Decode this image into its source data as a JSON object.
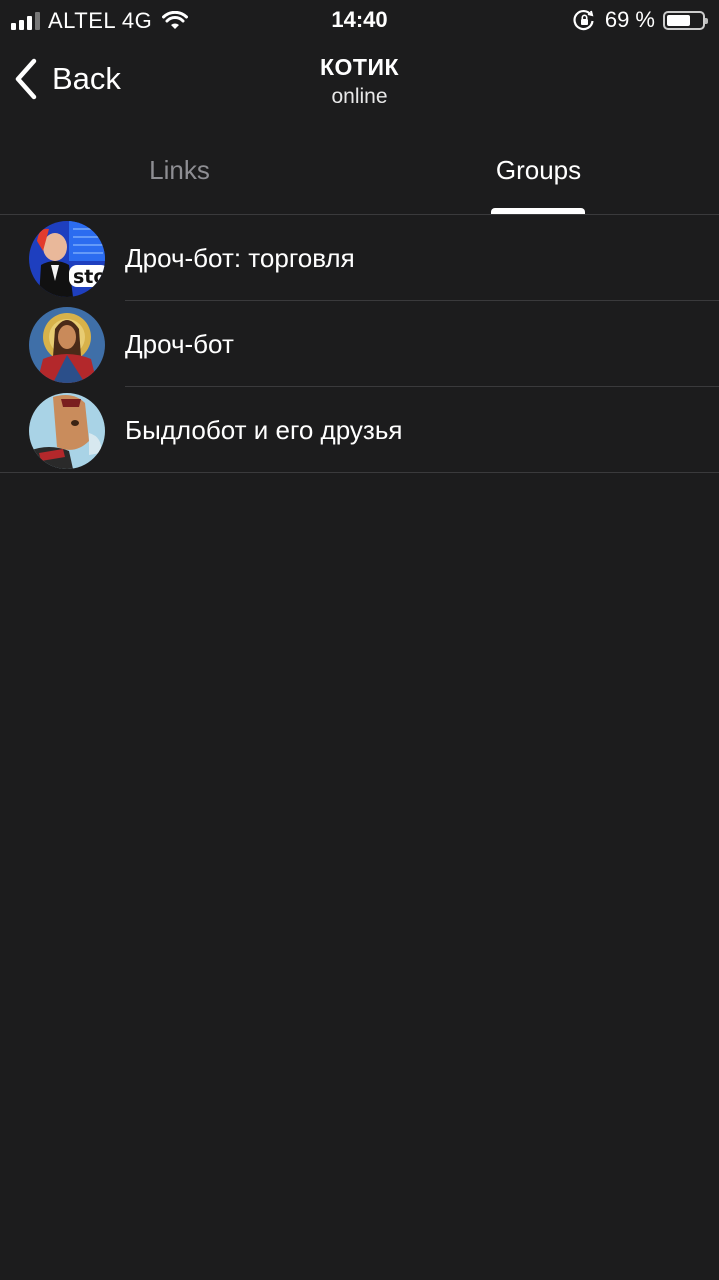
{
  "status_bar": {
    "carrier": "ALTEL 4G",
    "time": "14:40",
    "battery_percent": "69 %",
    "battery_level": 0.69,
    "signal_bars": 3,
    "signal_bars_total": 4
  },
  "header": {
    "back_label": "Back",
    "title": "КОТИК",
    "subtitle": "online"
  },
  "tabs": [
    {
      "label": "Links",
      "active": false
    },
    {
      "label": "Groups",
      "active": true
    }
  ],
  "groups": [
    {
      "name": "Дроч-бот: торговля",
      "avatar_icon": "stocks-avatar",
      "avatar_text": "sto"
    },
    {
      "name": "Дроч-бот",
      "avatar_icon": "icon-avatar"
    },
    {
      "name": "Быдлобот и его друзья",
      "avatar_icon": "cartoon-avatar"
    }
  ],
  "colors": {
    "background": "#1c1c1d",
    "text": "#ffffff",
    "inactive_tab": "#8e8e93",
    "separator": "#3a3a3c"
  }
}
